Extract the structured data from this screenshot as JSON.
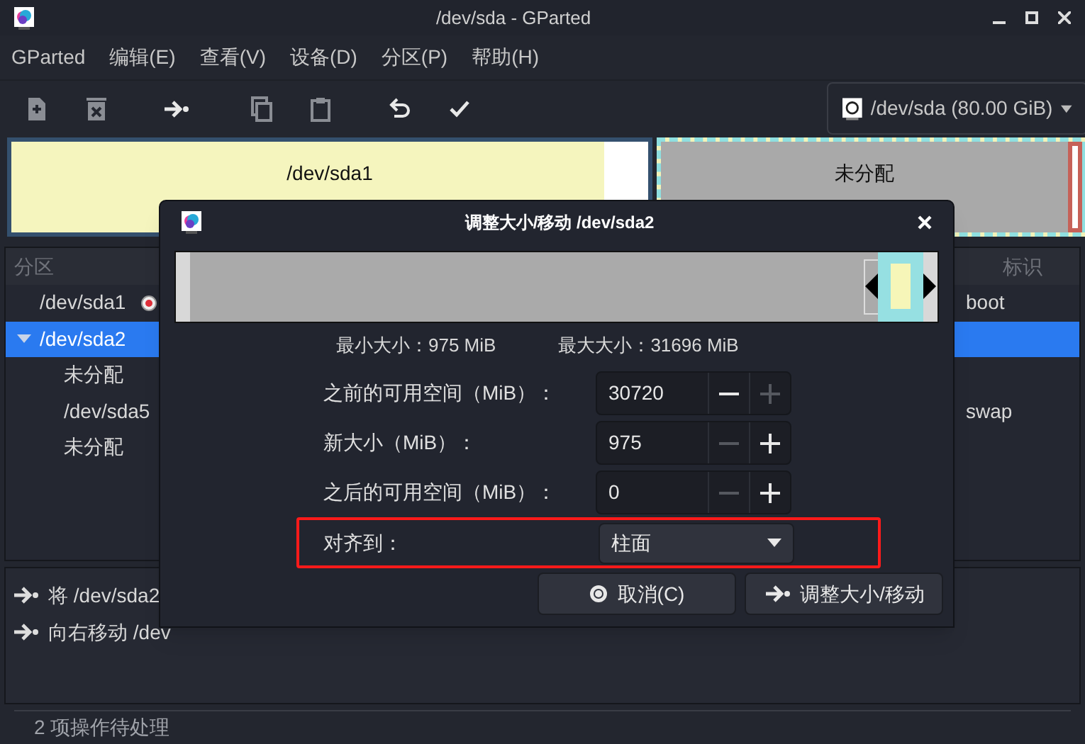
{
  "window": {
    "title": "/dev/sda - GParted"
  },
  "menu": [
    "GParted",
    "编辑(E)",
    "查看(V)",
    "设备(D)",
    "分区(P)",
    "帮助(H)"
  ],
  "toolbar": [
    {
      "kind": "new",
      "disabled": true
    },
    {
      "kind": "delete",
      "disabled": true
    },
    {
      "kind": "resize",
      "disabled": false
    },
    {
      "kind": "copy",
      "disabled": true
    },
    {
      "kind": "paste",
      "disabled": true
    },
    {
      "kind": "undo",
      "disabled": false
    },
    {
      "kind": "apply",
      "disabled": false
    }
  ],
  "device": {
    "label": "/dev/sda (80.00 GiB)"
  },
  "disk_map": [
    {
      "kind": "primary",
      "name": "/dev/sda1",
      "level": 0.93
    },
    {
      "kind": "extended",
      "name": "未分配"
    }
  ],
  "partitions": {
    "header": "分区",
    "flag_header": "标识",
    "rows": [
      {
        "name": "/dev/sda1",
        "selected": false,
        "busy": true,
        "flag": "boot"
      },
      {
        "name": "/dev/sda2",
        "selected": true,
        "busy": false,
        "expanded": true,
        "children": [
          {
            "name": "未分配",
            "selected": false,
            "busy": false
          },
          {
            "name": "/dev/sda5",
            "selected": false,
            "busy": false,
            "flag": "swap"
          },
          {
            "name": "未分配",
            "selected": false,
            "busy": false
          }
        ]
      }
    ]
  },
  "operations": [
    "将 /dev/sda2",
    "向右移动 /dev"
  ],
  "status": "2 项操作待处理",
  "dialog": {
    "title": "调整大小/移动 /dev/sda2",
    "min_label": "最小大小：975 MiB",
    "max_label": "最大大小：31696 MiB",
    "fields": [
      {
        "label": "之前的可用空间（MiB）：",
        "value": "30720",
        "minus_disabled": false,
        "plus_disabled": true
      },
      {
        "label": "新大小（MiB）：",
        "value": "975",
        "minus_disabled": true,
        "plus_disabled": false
      },
      {
        "label": "之后的可用空间（MiB）：",
        "value": "0",
        "minus_disabled": true,
        "plus_disabled": false
      }
    ],
    "align": {
      "label": "对齐到：",
      "value": "柱面",
      "highlighted": true
    },
    "buttons": [
      {
        "kind": "cancel",
        "label": "取消(C)"
      },
      {
        "kind": "resize",
        "label": "调整大小/移动"
      }
    ]
  }
}
